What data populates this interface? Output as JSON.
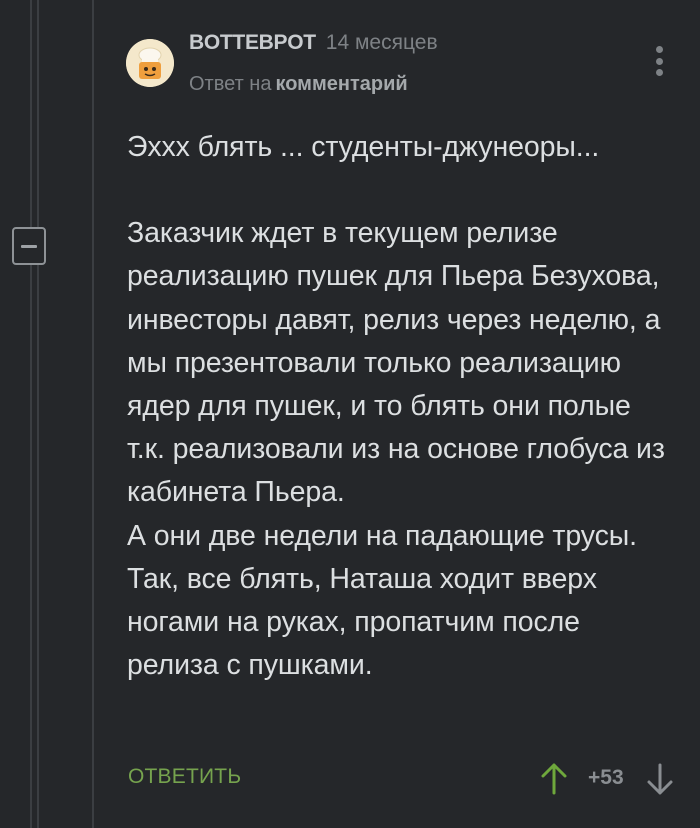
{
  "comment": {
    "author": "BOTTEBPOT",
    "time": "14 месяцев",
    "reply_prefix": "Ответ на",
    "reply_link": "комментарий",
    "lines": [
      "Эххх блять ... студенты-джунеоры...",
      "",
      "Заказчик ждет в текущем релизе реализацию пушек для Пьера Безухова, инвесторы давят, релиз через неделю, а мы презентовали только реализацию ядер для пушек, и то блять они полые т.к. реализовали из на основе глобуса из кабинета Пьера.",
      "А они две недели на падающие трусы. Так, все блять, Наташа ходит вверх ногами на руках, пропатчим после релиза с пушками."
    ],
    "reply_label": "ОТВЕТИТЬ",
    "rating": "+53"
  },
  "icons": {
    "avatar": "chef-avatar-icon",
    "more": "more-vertical-icon",
    "collapse": "collapse-minus-icon",
    "vote_up": "arrow-up-icon",
    "vote_down": "arrow-down-icon"
  },
  "colors": {
    "background": "#25272a",
    "text": "#dcdfe1",
    "muted": "#7e8286",
    "reply_green": "#76a34e",
    "upvote_green": "#6fa83c"
  }
}
